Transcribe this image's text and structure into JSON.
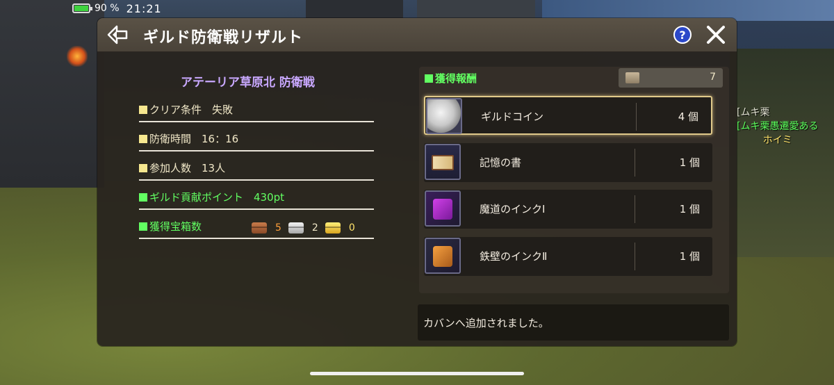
{
  "status_bar": {
    "battery": "90 %",
    "battery_level": 0.9,
    "time": "21:21"
  },
  "background_chat": {
    "line1": "[ムキ栗",
    "line2": "[ムキ栗愚遷愛ある",
    "line3": "ホイミ"
  },
  "header": {
    "title": "ギルド防衛戦リザルト",
    "help_label": "?"
  },
  "stage": {
    "name": "アテーリア草原北 防衛戦"
  },
  "stats": {
    "clear": "クリア条件　失敗",
    "defense_time": "防衛時間　16：16",
    "participants": "参加人数　13人",
    "guild_points": "ギルド貢献ポイント　430pt",
    "chests_label": "獲得宝箱数",
    "chest_bronze": "5",
    "chest_silver": "2",
    "chest_gold": "0"
  },
  "rewards": {
    "header": "獲得報酬",
    "total": "7",
    "items": [
      {
        "name": "ギルドコイン",
        "qty": "4 個",
        "icon": "guild-coin-icon"
      },
      {
        "name": "記憶の書",
        "qty": "1 個",
        "icon": "book-icon"
      },
      {
        "name": "魔道のインクⅠ",
        "qty": "1 個",
        "icon": "ink-icon"
      },
      {
        "name": "鉄壁のインクⅡ",
        "qty": "1 個",
        "icon": "ink-icon"
      }
    ]
  },
  "message": "カバンへ追加されました。",
  "colors": {
    "accent_green": "#62ff62",
    "stage_purple": "#c9a8ff",
    "help_blue": "#2b48c9"
  }
}
